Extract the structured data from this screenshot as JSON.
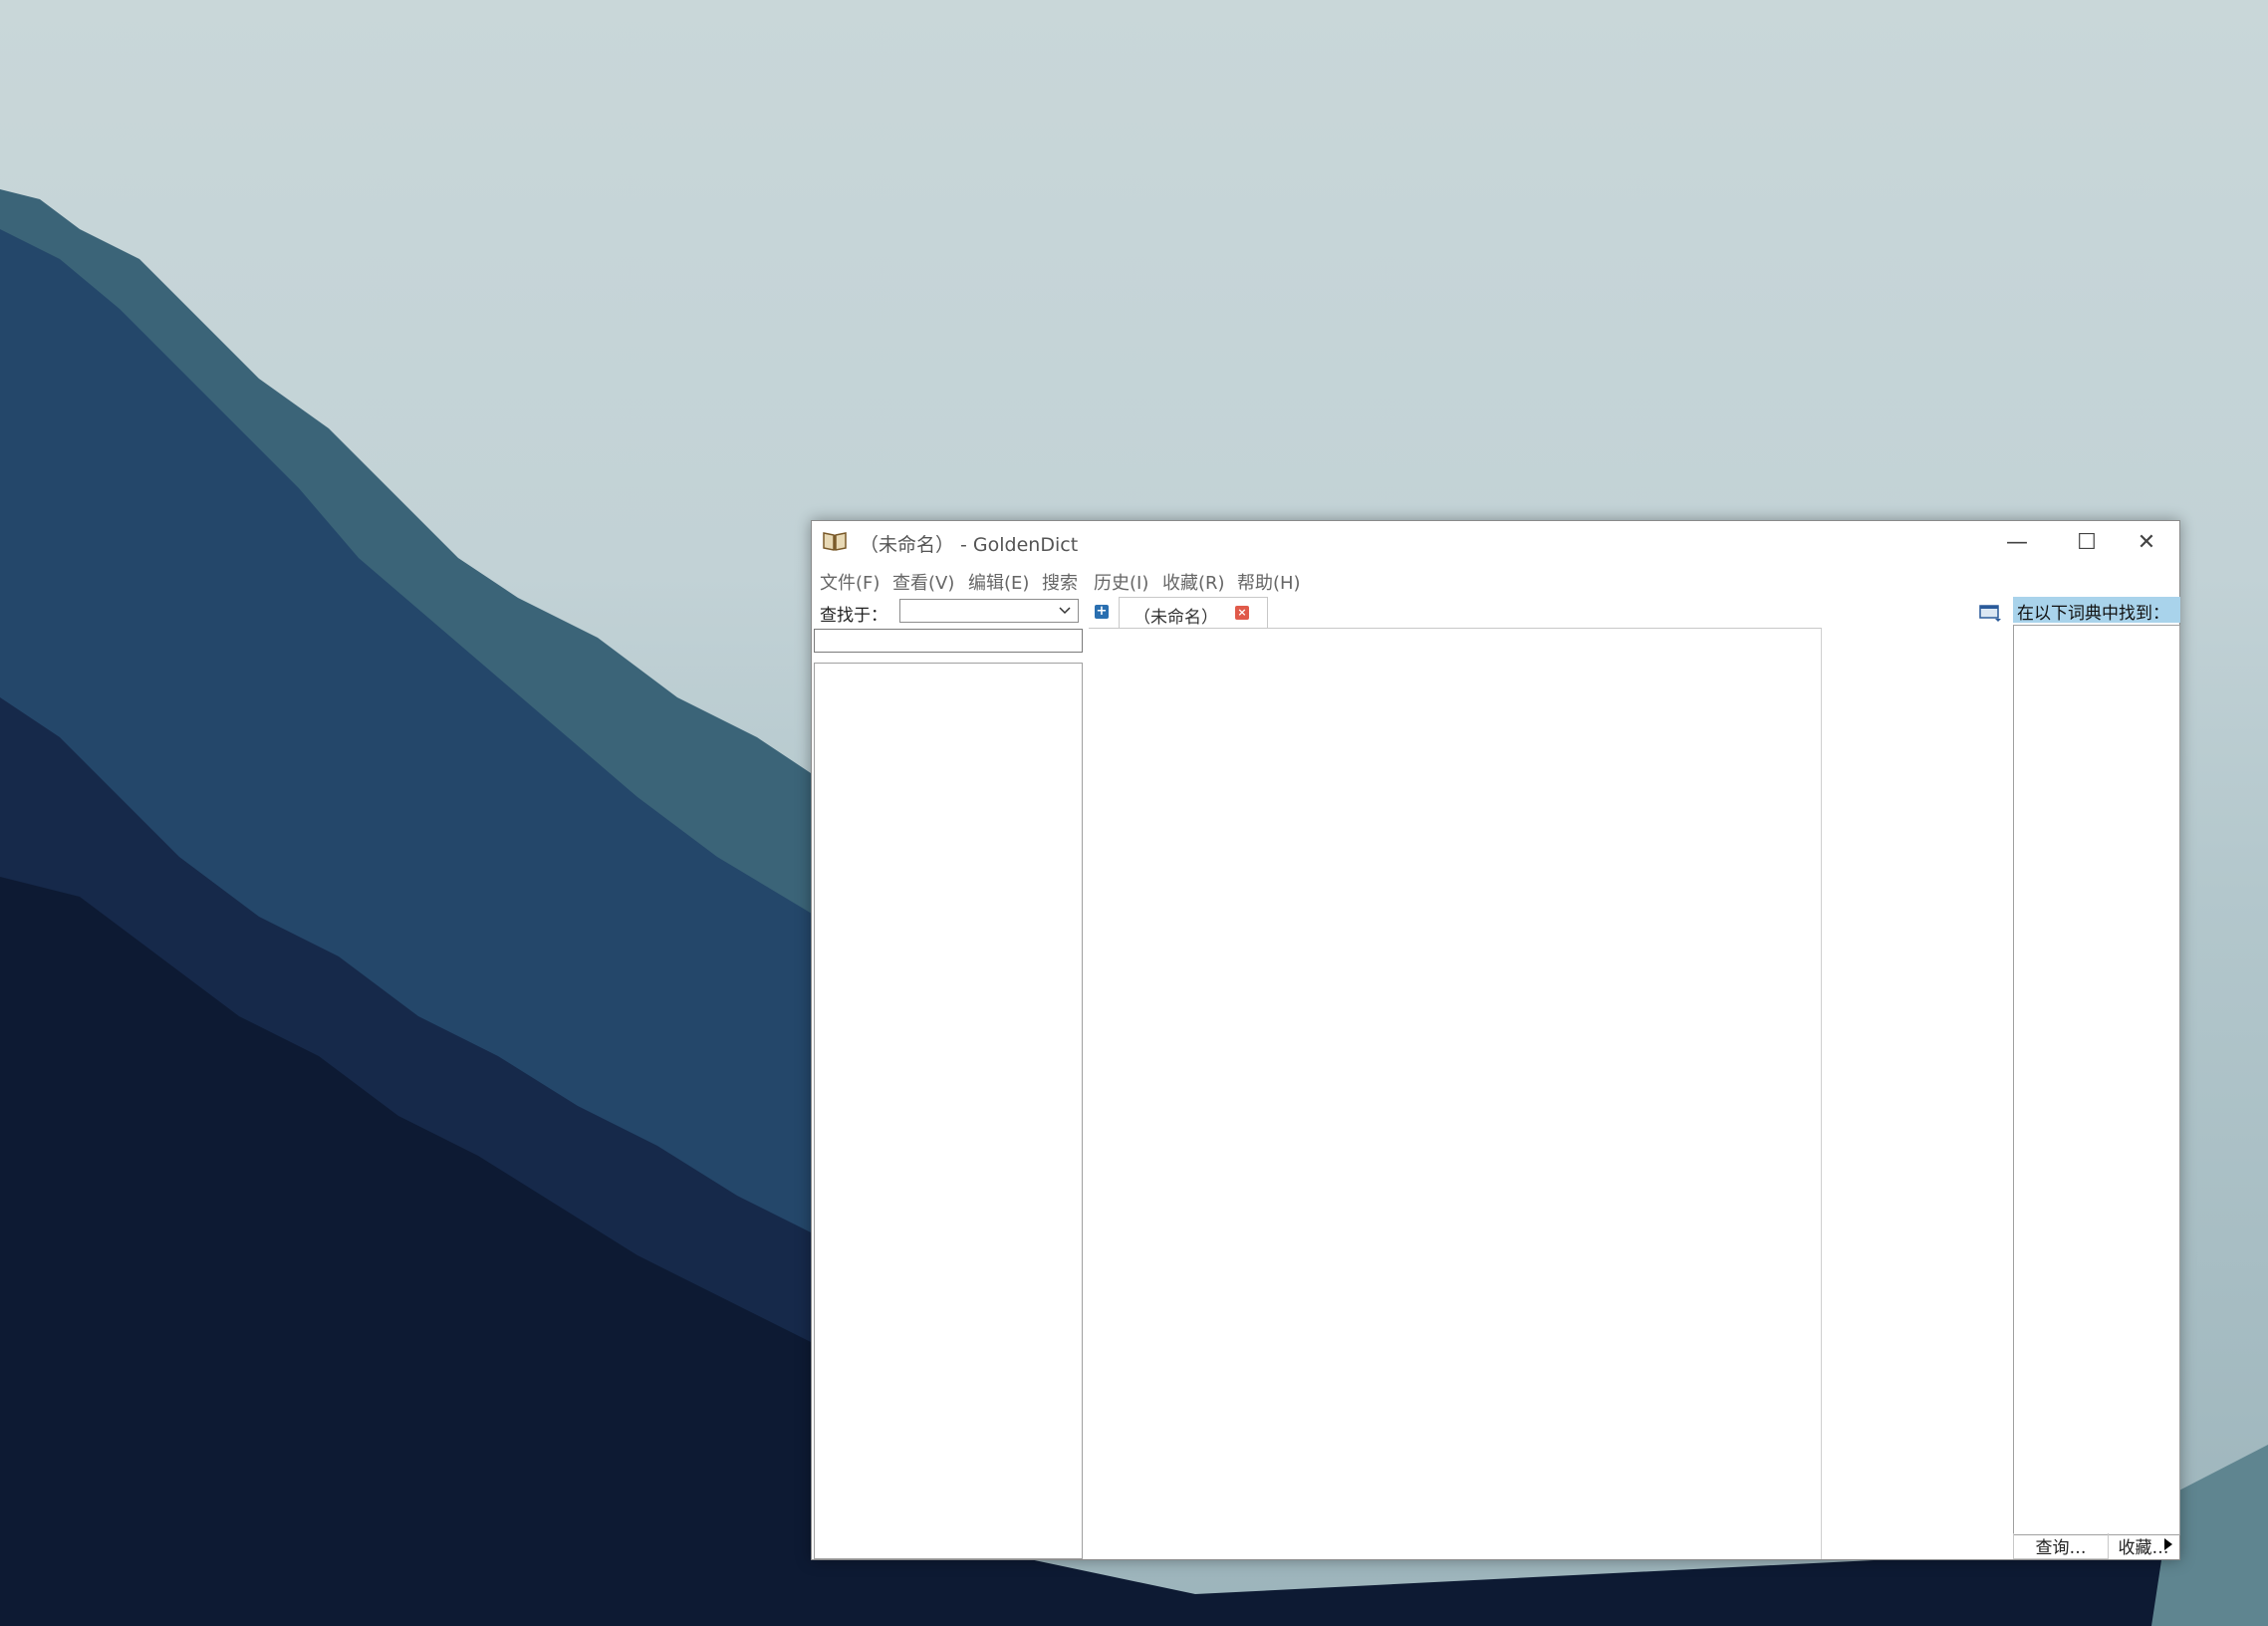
{
  "window": {
    "title": "（未命名） - GoldenDict",
    "minimize_glyph": "—",
    "maximize_glyph": "☐",
    "close_glyph": "✕"
  },
  "menu": [
    "文件(F)",
    "查看(V)",
    "编辑(E)",
    "搜索",
    "历史(I)",
    "收藏(R)",
    "帮助(H)"
  ],
  "search": {
    "label": "查找于：",
    "group_selected": "",
    "word_value": ""
  },
  "tabs": [
    {
      "label": "（未命名）"
    }
  ],
  "dictionaries_pane": {
    "title": "在以下词典中找到："
  },
  "bottom_tabs": [
    "查询…",
    "收藏…"
  ],
  "icons": {
    "app": "book-icon",
    "add_tab": "plus-icon",
    "close_tab": "close-icon",
    "tab_list": "window-list-icon",
    "combo": "chevron-down-icon"
  },
  "colors": {
    "dict_title_bg": "#a9d3eb",
    "close_tab": "#e05a4a",
    "add_tab": "#2a6fb0"
  }
}
